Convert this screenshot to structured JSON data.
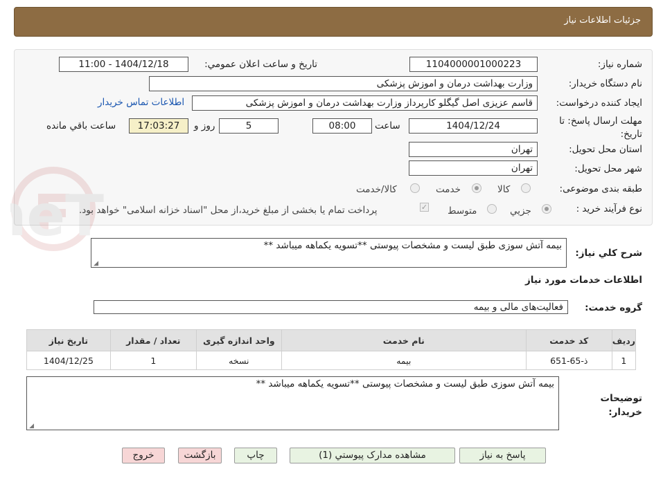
{
  "header": {
    "title": "جزئیات اطلاعات نیاز"
  },
  "form": {
    "need_number_label": "شماره نیاز:",
    "need_number": "1104000001000223",
    "announce_label": "تاریخ و ساعت اعلان عمومي:",
    "announce_value": "1404/12/18 - 11:00",
    "buyer_org_label": "نام دستگاه خريدار:",
    "buyer_org": "وزارت بهداشت  درمان و اموزش پزشکی",
    "creator_label": "ايجاد کننده درخواست:",
    "creator": "قاسم عزیزی اصل گیگلو کارپرداز وزارت بهداشت  درمان و اموزش پزشکی",
    "contact_link": "اطلاعات تماس خریدار",
    "deadline_label": "مهلت ارسال پاسخ: تا تاریخ:",
    "deadline_date": "1404/12/24",
    "time_label": "ساعت",
    "deadline_time": "08:00",
    "days_value": "5",
    "days_label": "روز و",
    "remaining_time": "17:03:27",
    "remaining_label": "ساعت باقي مانده",
    "province_label": "استان محل تحویل:",
    "province": "تهران",
    "city_label": "شهر محل تحویل:",
    "city": "تهران",
    "category_label": "طبقه بندی موضوعی:",
    "category_options": [
      "کالا",
      "خدمت",
      "کالا/خدمت"
    ],
    "category_selected": "خدمت",
    "process_label": "نوع فرآیند خرید :",
    "process_options": [
      "جزيي",
      "متوسط"
    ],
    "process_selected": "جزيي",
    "payment_note": "پرداخت تمام یا بخشی از مبلغ خرید،از محل \"اسناد خزانه اسلامی\" خواهد بود.",
    "payment_checked": true
  },
  "summary": {
    "label": "شرح کلي نياز:",
    "value": "بیمه آتش سوزی طبق لیست و مشخصات پیوستی **تسویه یکماهه میباشد **"
  },
  "services": {
    "section_title": "اطلاعات خدمات مورد نياز",
    "group_label": "گروه خدمت:",
    "group_value": "فعالیت‌های مالی و بیمه",
    "columns": [
      "رديف",
      "کد خدمت",
      "نام خدمت",
      "واحد اندازه گیری",
      "تعداد / مقدار",
      "تاريخ نياز"
    ],
    "rows": [
      [
        "1",
        "ذ-65-651",
        "بیمه",
        "نسخه",
        "1",
        "1404/12/25"
      ]
    ]
  },
  "buyer_notes": {
    "label": "توضيحات خريدار:",
    "value": "بیمه آتش سوزی طبق لیست و مشخصات پیوستی **تسویه یکماهه میباشد **"
  },
  "buttons": {
    "reply": "پاسخ به نياز",
    "attachments": "مشاهده مدارک پيوستي (1)",
    "print": "چاپ",
    "back": "بازگشت",
    "exit": "خروج"
  },
  "watermark": {
    "text": "AriaTender.neT"
  },
  "colors": {
    "header_bg": "#8d6c43",
    "button_green": "#e8f3e2",
    "button_pink": "#f7d6d6",
    "link": "#1a56b0"
  }
}
